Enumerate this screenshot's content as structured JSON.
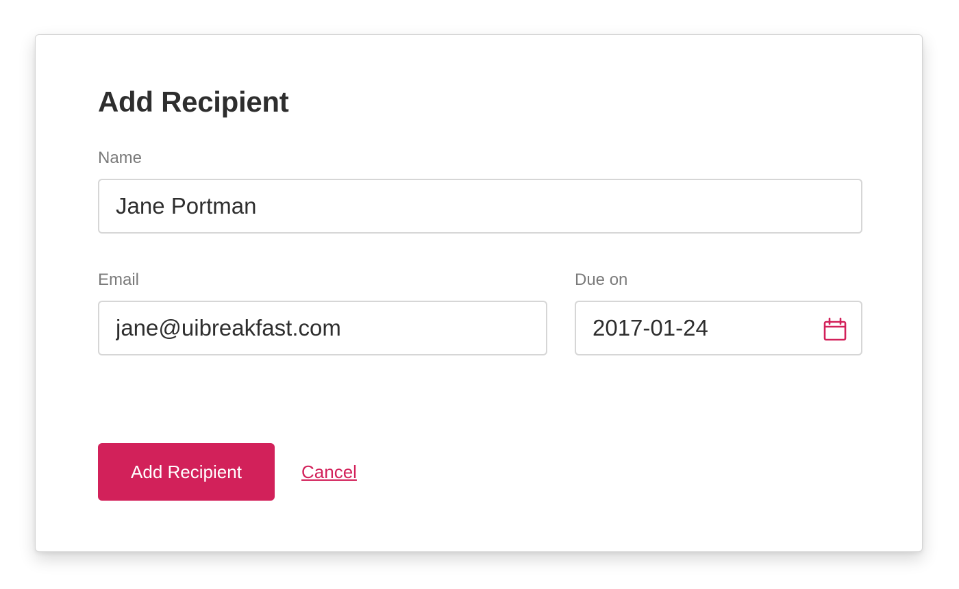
{
  "dialog": {
    "title": "Add Recipient"
  },
  "form": {
    "name": {
      "label": "Name",
      "value": "Jane Portman"
    },
    "email": {
      "label": "Email",
      "value": "jane@uibreakfast.com"
    },
    "due_on": {
      "label": "Due on",
      "value": "2017-01-24",
      "icon": "calendar-icon"
    }
  },
  "actions": {
    "submit_label": "Add Recipient",
    "cancel_label": "Cancel"
  },
  "colors": {
    "accent": "#d2215a",
    "text": "#2e2e2e",
    "label": "#7a7a7a",
    "border": "#d6d6d6"
  }
}
